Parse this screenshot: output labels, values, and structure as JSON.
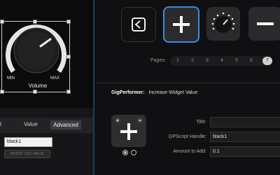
{
  "left_panel": {
    "knob": {
      "label": "Volume",
      "min_label": "MIN",
      "max_label": "MAX"
    },
    "tabs": {
      "value": "Value",
      "advanced": "Advanced",
      "partial_left": "t"
    },
    "name_field": "black1",
    "invert_button": "INVERT OSC VALUE"
  },
  "right_panel": {
    "toolbar": {
      "back_icon": "back-icon",
      "plus_icon": "plus-icon",
      "knob_icon": "knob-icon",
      "minus_icon": "minus-icon"
    },
    "pages": {
      "label": "Pages:",
      "items": [
        "1",
        "2",
        "3",
        "4",
        "5",
        "6",
        "7"
      ],
      "active": "7"
    },
    "inspector": {
      "app": "GigPerformer:",
      "action": "Increase Widget Value",
      "title_label": "Title:",
      "title_value": "",
      "handle_label": "GPScript Handle:",
      "handle_value": "black1",
      "amount_label": "Amount to Add:",
      "amount_value": "0.1"
    }
  },
  "colors": {
    "accent_blue": "#3a8be0",
    "divider": "#1b3a66"
  }
}
